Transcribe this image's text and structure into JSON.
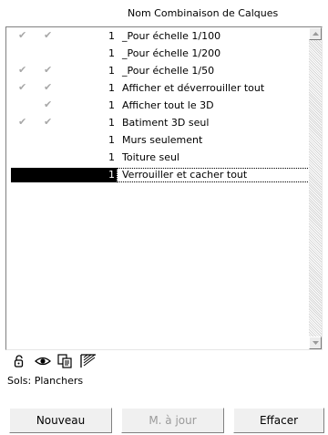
{
  "header": {
    "title": "Nom Combinaison de Calques"
  },
  "list": {
    "rows": [
      {
        "check1": "✔",
        "check2": "✔",
        "num": "1",
        "name": "_Pour échelle 1/100",
        "selected": false
      },
      {
        "check1": "",
        "check2": "",
        "num": "1",
        "name": "_Pour échelle 1/200",
        "selected": false
      },
      {
        "check1": "✔",
        "check2": "✔",
        "num": "1",
        "name": "_Pour échelle 1/50",
        "selected": false
      },
      {
        "check1": "✔",
        "check2": "✔",
        "num": "1",
        "name": "Afficher et déverrouiller tout",
        "selected": false
      },
      {
        "check1": "",
        "check2": "✔",
        "num": "1",
        "name": "Afficher tout le 3D",
        "selected": false
      },
      {
        "check1": "✔",
        "check2": "✔",
        "num": "1",
        "name": "Batiment 3D seul",
        "selected": false
      },
      {
        "check1": "",
        "check2": "",
        "num": "1",
        "name": "Murs seulement",
        "selected": false
      },
      {
        "check1": "",
        "check2": "",
        "num": "1",
        "name": "Toiture seul",
        "selected": false
      },
      {
        "check1": "",
        "check2": "",
        "num": "1",
        "name": "Verrouiller et cacher tout",
        "selected": true
      }
    ]
  },
  "status": {
    "icons": [
      "lock-icon",
      "eye-icon",
      "copy-icon",
      "hatch-icon"
    ],
    "label": "Sols: Planchers"
  },
  "buttons": {
    "new_label": "Nouveau",
    "update_label": "M. à jour",
    "delete_label": "Effacer"
  }
}
